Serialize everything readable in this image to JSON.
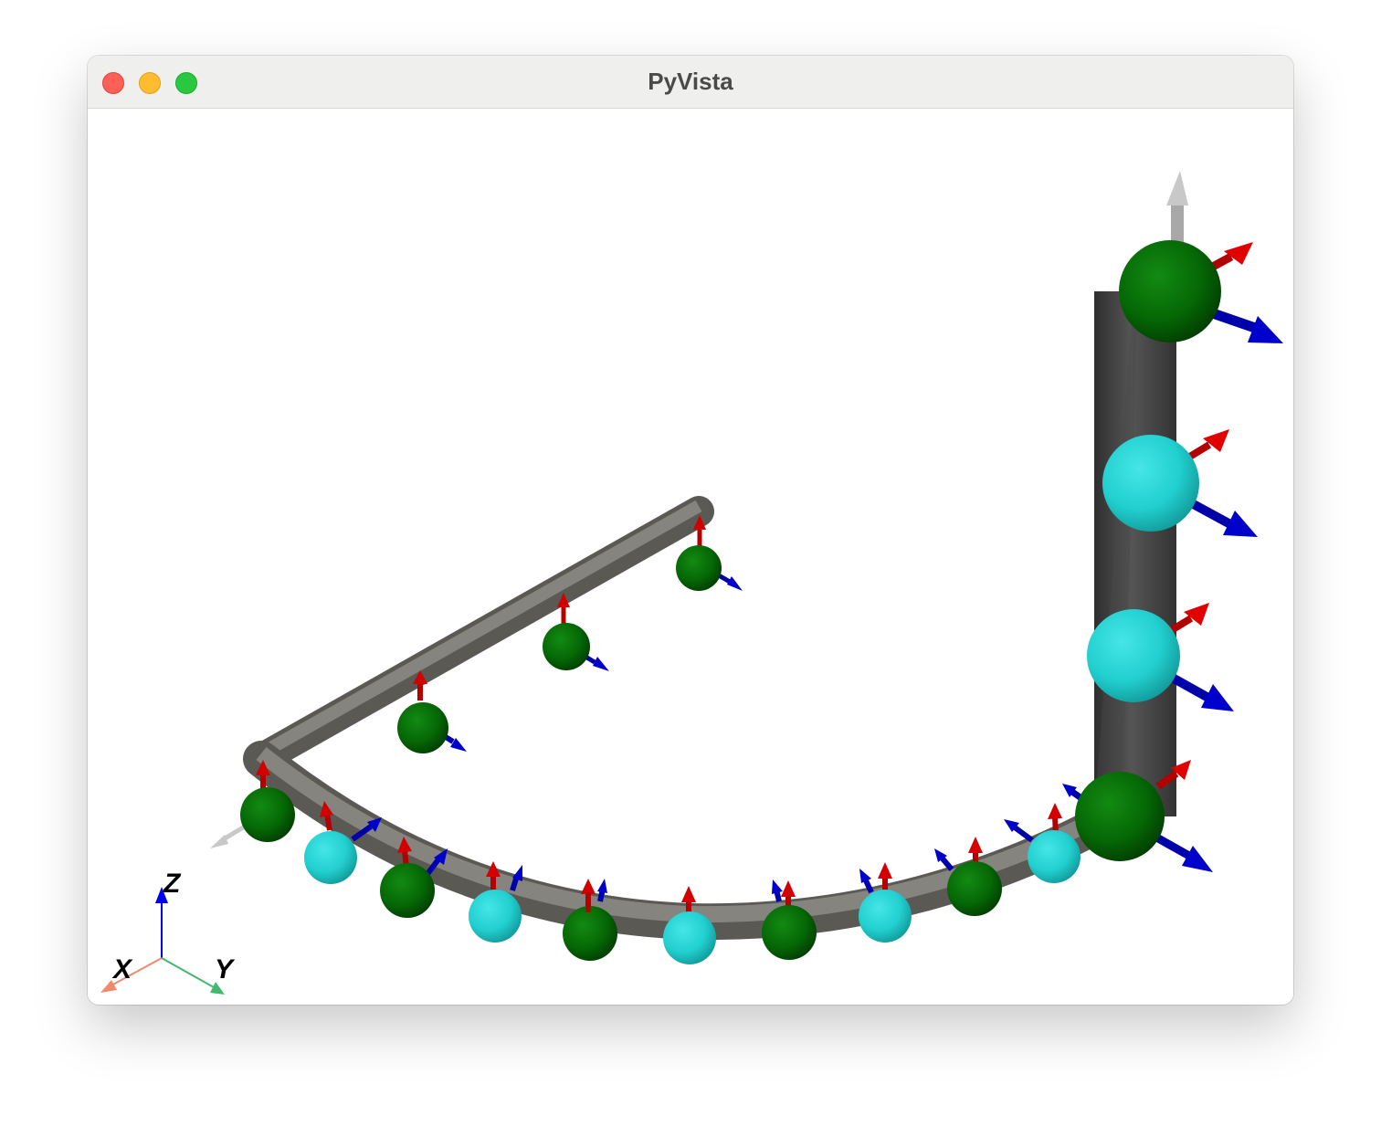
{
  "window": {
    "title": "PyVista",
    "controls": [
      "close-button",
      "minimize-button",
      "zoom-button"
    ]
  },
  "colors": {
    "tube": "#7a7872",
    "tube_vertical": "#484848",
    "node_green": "#056805",
    "node_cyan": "#22cfcf",
    "arrow_red": "#d20000",
    "arrow_blue": "#0000cc",
    "arrow_gray": "#c8c8c8",
    "axis_x": "#f08a6a",
    "axis_y": "#45b870",
    "axis_z": "#0000ee"
  },
  "orientation_axes": {
    "x_label": "X",
    "y_label": "Y",
    "z_label": "Z"
  }
}
